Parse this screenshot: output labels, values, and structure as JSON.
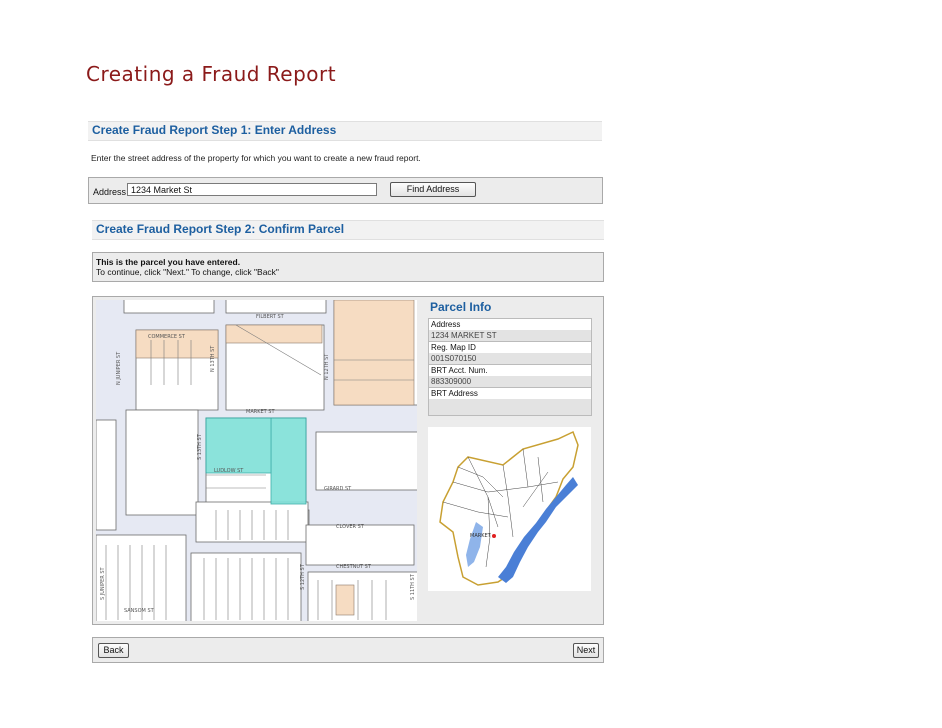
{
  "document": {
    "title": "Creating a Fraud Report"
  },
  "step1": {
    "header": "Create Fraud Report Step 1: Enter Address",
    "instructions": "Enter the street address of the property for which you want to create a new fraud report.",
    "address_label": "Address",
    "address_value": "1234 Market St",
    "find_button": "Find Address"
  },
  "step2": {
    "header": "Create Fraud Report Step 2: Confirm Parcel",
    "confirm_line1": "This is the parcel you have entered.",
    "confirm_line2": "To continue, click \"Next.\" To change, click \"Back\""
  },
  "map": {
    "streets": {
      "filbert": "FILBERT ST",
      "commerce": "COMMERCE ST",
      "market": "MARKET ST",
      "ludlow": "LUDLOW ST",
      "chestnut": "CHESTNUT ST",
      "clover": "CLOVER ST",
      "girard": "GIRARD ST",
      "sansom": "SANSOM ST",
      "n13th": "N 13TH ST",
      "n12th": "N 12TH ST",
      "s13th": "S 13TH ST",
      "s12th": "S 12TH ST",
      "juniper": "S JUNIPER ST",
      "n_juniper": "N JUNIPER ST",
      "s11th": "S 11TH ST"
    },
    "colors": {
      "street": "#b5bdd8",
      "parcel": "#6fd6d0",
      "building": "#f5d9bd"
    }
  },
  "parcel_info": {
    "title": "Parcel Info",
    "fields": [
      {
        "label": "Address",
        "value": "1234 MARKET ST"
      },
      {
        "label": "Reg. Map ID",
        "value": "001S070150"
      },
      {
        "label": "BRT Acct. Num.",
        "value": "883309000"
      },
      {
        "label": "BRT Address",
        "value": ""
      }
    ]
  },
  "inset_map": {
    "label_market": "MARKET",
    "colors": {
      "river": "#4a7fd6",
      "border": "#c8a032"
    }
  },
  "nav": {
    "back": "Back",
    "next": "Next"
  }
}
